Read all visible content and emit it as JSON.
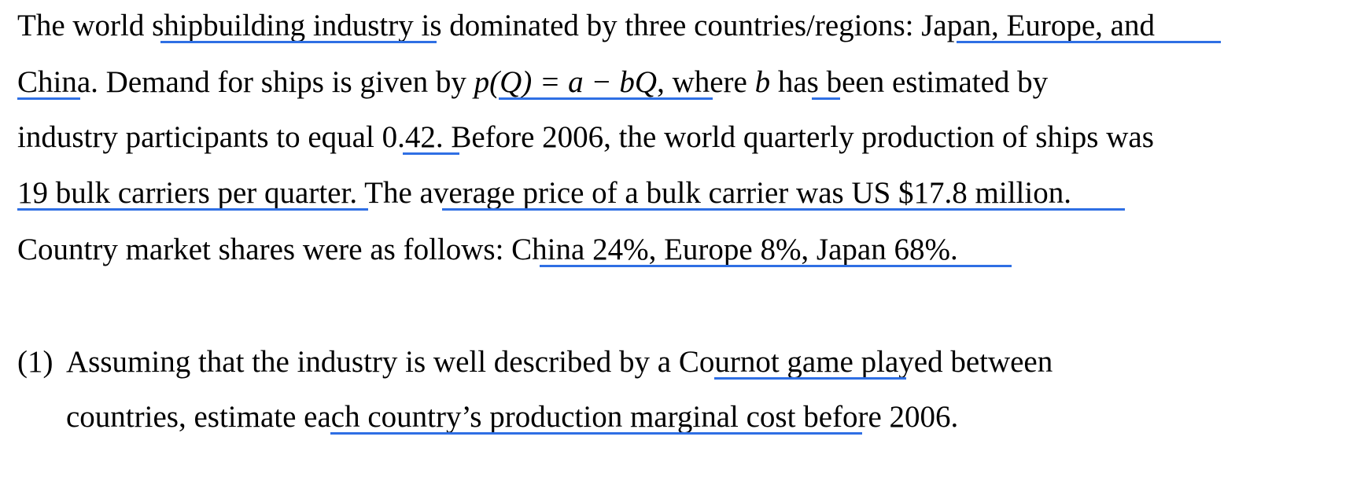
{
  "paragraph": {
    "line1": {
      "a": "The world ",
      "b": "shipbuilding industry",
      "c": " is dominated by three countries/regions",
      "d": ": Japan, Europe, and"
    },
    "line2": {
      "a": "China",
      "b": ". Demand for ships is given by ",
      "formula": "p(Q) = a − bQ",
      "c": ", where ",
      "b_var": "b",
      "d": " has been estimated by"
    },
    "line3": {
      "a": "industry participants to equal ",
      "value": "0.42",
      "b": ". Before 2006, the world quarterly production of ships was"
    },
    "line4": {
      "a": "19 bulk carriers per quarter",
      "b": ". The ",
      "c": "average price of a bulk carrier was US $17.8 million",
      "d": "."
    },
    "line5": {
      "a": "Country market shares were as follows: ",
      "b": "China 24%, Europe 8%, Japan 68%."
    }
  },
  "question": {
    "number": "(1)",
    "line1": {
      "a": "Assuming that the industry is well described by a ",
      "b": "Cournot game ",
      "c": "played between"
    },
    "line2": {
      "a": "countries, estimate ",
      "b": "each country’s production marginal cost ",
      "c": "before 2006."
    }
  },
  "colors": {
    "text": "#000000",
    "underline": "#2f6fe4",
    "background": "#ffffff"
  }
}
